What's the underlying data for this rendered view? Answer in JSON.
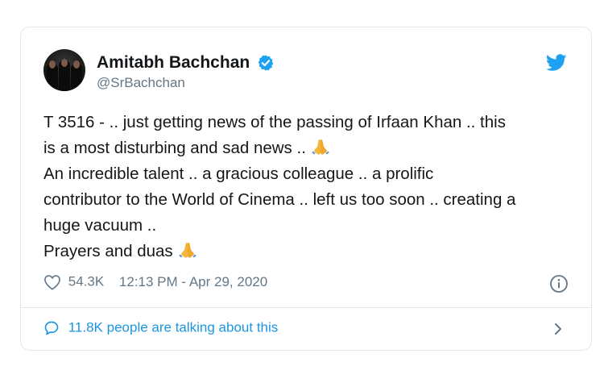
{
  "tweet": {
    "display_name": "Amitabh Bachchan",
    "handle": "@SrBachchan",
    "text_lines": [
      "T 3516 - .. just getting news of the passing of Irfaan Khan .. this",
      "is a most disturbing and sad news ..",
      "An incredible talent .. a gracious colleague .. a prolific",
      "contributor to the World of Cinema .. left us too soon .. creating a",
      "huge vacuum ..",
      "Prayers and duas"
    ],
    "likes": "54.3K",
    "timestamp": "12:13 PM - Apr 29, 2020",
    "talking": "11.8K people are talking about this"
  },
  "icons": {
    "brand": "twitter-bird-icon",
    "verified": "verified-badge-icon",
    "emoji": "folded-hands-emoji",
    "like": "heart-icon",
    "info": "info-icon",
    "comment": "comment-bubble-icon",
    "chevron": "chevron-right-icon"
  },
  "colors": {
    "accent": "#1da1f2",
    "link": "#1b95e0",
    "muted": "#657786",
    "text": "#14171a",
    "border": "#e1e8ed"
  }
}
